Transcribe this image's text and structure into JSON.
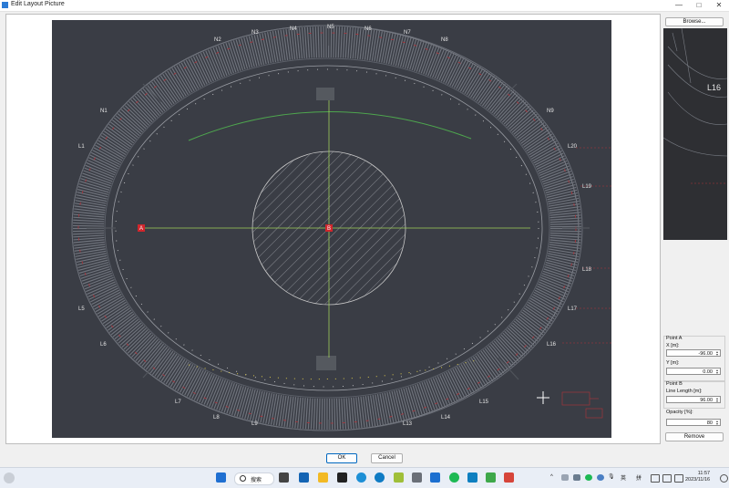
{
  "window": {
    "title": "Edit Layout Picture",
    "minimize": "—",
    "maximize": "□",
    "close": "✕"
  },
  "layout": {
    "section_labels_top": [
      "N2",
      "N3",
      "N4",
      "N5",
      "N6",
      "N7",
      "N8"
    ],
    "section_labels_left": [
      "N1",
      "L1",
      "L5",
      "L6"
    ],
    "section_labels_right": [
      "N9",
      "L20",
      "L19",
      "L18",
      "L17",
      "L16"
    ],
    "section_labels_bottom": [
      "L7",
      "L8",
      "L9",
      "L13",
      "L14",
      "L15"
    ],
    "point_a_marker": "A",
    "point_b_marker": "B",
    "background_color": "#3a3d45"
  },
  "right_panel": {
    "browse_label": "Browse...",
    "preview_label": "L16",
    "point_a": {
      "title": "Point A",
      "x_label": "X [m]:",
      "x_value": "-96.00",
      "y_label": "Y [m]:",
      "y_value": "0.00"
    },
    "point_b": {
      "title": "Point B",
      "line_length_label": "Line Length [m]:",
      "line_length_value": "96.00"
    },
    "opacity": {
      "label": "Opacity [%]:",
      "value": "80"
    },
    "remove_label": "Remove"
  },
  "dialog": {
    "ok_label": "OK",
    "cancel_label": "Cancel"
  },
  "taskbar": {
    "search_label": "搜索",
    "language": "英",
    "ime": "拼",
    "time": "11:57",
    "date": "2023/11/16"
  }
}
